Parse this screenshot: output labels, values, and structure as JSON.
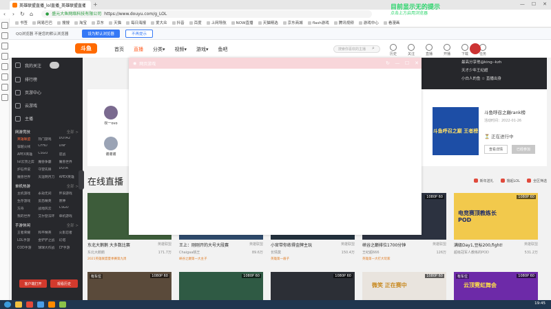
{
  "browser": {
    "tab_title": "英雄联盟直播_lol直播_英雄联盟直播平台",
    "url": "https://www.douyu.com/g_LOL",
    "url_prefix": "盛元大鱼网络科技有限公司",
    "bookmarks": [
      "书签",
      "网易巴巴",
      "搜搜",
      "淘宝",
      "京东",
      "天猫",
      "每日海报",
      "爱大众",
      "抖音",
      "百度",
      "上网导航",
      "NOW直播",
      "天猫精选",
      "京东商城",
      "flash游戏",
      "腾讯视频",
      "游戏中心",
      "看漫画"
    ],
    "qq_prompt": "QQ浏览器 不是您的默认浏览器",
    "set_default_label": "设为默认浏览器",
    "no_prompt_label": "不再提示"
  },
  "watermark": {
    "line1": "目前显示无的提示",
    "line2": "点击上方启用浏览器"
  },
  "site": {
    "logo_text": "斗鱼",
    "nav": [
      "首页",
      "直播",
      "分类▾",
      "视频▾",
      "游戏▾",
      "鱼吧"
    ],
    "active_nav_index": 1,
    "search_placeholder": "搜索你喜欢的主播",
    "header_icons": [
      "历史",
      "关注",
      "直播",
      "开播",
      "下载",
      "任务"
    ]
  },
  "left_nav": {
    "user_label": "我的关注",
    "items": [
      "排行榜",
      "页游中心",
      "云游戏",
      "主播"
    ],
    "section1": {
      "title": "网游竞技",
      "more": "全部 >",
      "games": [
        "英雄联盟",
        "热门游戏",
        "DOTA2",
        "穿越火线",
        "CFHD",
        "DNF",
        "APEX英雄",
        "CSGO",
        "逆战",
        "lol云顶之弈",
        "魔兽争霸",
        "魔兽世界",
        "炉石传说",
        "守望先锋",
        "DOTA",
        "魔兽世界",
        "天涯明月刀",
        "APEX英雄"
      ]
    },
    "section2": {
      "title": "单机热游",
      "more": "全部 >",
      "games": [
        "主机游戏",
        "永劫无间",
        "怀旧游戏",
        "生存游戏",
        "反恐精英",
        "原神",
        "方舟",
        "战地风云",
        "CSGO",
        "我的世界",
        "艾尔登法环",
        "单机游戏"
      ]
    },
    "section3": {
      "title": "手游休闲",
      "more": "全部 >",
      "games": [
        "王者荣耀",
        "和平精英",
        "火影忍者",
        "LOL手游",
        "金铲铲之战",
        "幻塔",
        "COD手游",
        "球球大作战",
        "CF手游"
      ]
    },
    "btn_open_live": "客户端打开",
    "btn_download": "观看历史"
  },
  "rank": {
    "items": [
      "最高分享他@king--kzh",
      "天才少年王纪超",
      "小白人的鱼 ☆ 直播出身"
    ]
  },
  "promo": {
    "streamers": [
      {
        "name": "叹一ovo"
      },
      {
        "name": "谢谢谢"
      }
    ],
    "event_image_text": "斗鱼呼召之巅 王者榜",
    "event_title": "斗鱼呼召之巅rank榜",
    "event_date": "活动时间：2022-01-26",
    "event_status": "正在进行中",
    "btn_view": "查看详情",
    "btn_join": "已经参加"
  },
  "live": {
    "title": "在线直播",
    "filters": [
      "新年送礼",
      "撸起LOL",
      "全区筛选"
    ],
    "cards": [
      {
        "title": "东北大鹅鹅 大多数比赛",
        "category": "英雄联盟",
        "streamer": "东北大鹅鹅",
        "views": "171.7万",
        "tag": "2021英雄联盟夏季赛第九周",
        "quality": "1080P 60"
      },
      {
        "title": "王上：刚刚开的大号大段赛",
        "category": "英雄联盟",
        "streamer": "Chaigaa桃王",
        "views": "89.6万",
        "tag": "峡谷之巅第一大主子",
        "quality": "1080P 60"
      },
      {
        "title": "小官带你练得金牌主玩",
        "category": "英雄联盟",
        "streamer": "长情莫",
        "views": "150.4万",
        "tag": "英雄第一盾子",
        "quality": "1080P 60"
      },
      {
        "title": "峡谷之巅排位1700分钟",
        "category": "英雄联盟",
        "streamer": "王纪超666",
        "views": "126万",
        "tag": "英雄第一大打大玩家",
        "quality": "1080P 60"
      },
      {
        "title": "满级Day1,豆标200,fight!",
        "category": "英雄联盟",
        "streamer": "超级冠军人教练的POD",
        "views": "531.2万",
        "tag": "",
        "quality": "1080P 60",
        "image_text": "电竞赛顶教练长 POD"
      }
    ],
    "row2": [
      {
        "tag": "有车位",
        "quality": "1080P 60"
      },
      {
        "tag": "",
        "quality": "1080P 60"
      },
      {
        "tag": "",
        "quality": "1080P 60"
      },
      {
        "tag": "",
        "quality": "1080P 60",
        "image_text": "微笑 正在赛中"
      },
      {
        "tag": "有车位",
        "quality": "1080P 60",
        "image_text": "云顶霓虹舞会"
      }
    ]
  },
  "modal": {
    "title": "网页游戏"
  },
  "taskbar": {
    "clock": "19:45"
  }
}
